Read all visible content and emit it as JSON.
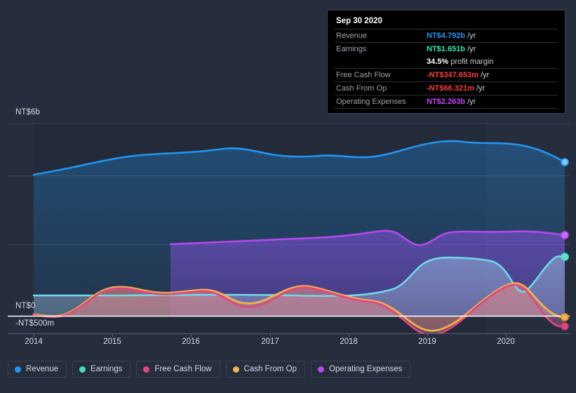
{
  "tooltip": {
    "title": "Sep 30 2020",
    "rows": [
      {
        "key": "Revenue",
        "amount": "NT$4.792b",
        "unit": "/yr",
        "color": "#2196f3"
      },
      {
        "key": "Earnings",
        "amount": "NT$1.651b",
        "unit": "/yr",
        "color": "#2ee6b8"
      },
      {
        "key": "",
        "amount": "34.5%",
        "unit": "profit margin",
        "color": "#ffffff"
      },
      {
        "key": "Free Cash Flow",
        "amount": "-NT$347.653m",
        "unit": "/yr",
        "color": "#ff3b3b"
      },
      {
        "key": "Cash From Op",
        "amount": "-NT$66.321m",
        "unit": "/yr",
        "color": "#ff3b3b"
      },
      {
        "key": "Operating Expenses",
        "amount": "NT$2.263b",
        "unit": "/yr",
        "color": "#c644fc"
      }
    ]
  },
  "axis": {
    "y_labels": [
      {
        "id": "y-top",
        "text": "NT$6b"
      },
      {
        "id": "y-zero",
        "text": "NT$0"
      },
      {
        "id": "y-neg",
        "text": "-NT$500m"
      }
    ],
    "x_labels": [
      "2014",
      "2015",
      "2016",
      "2017",
      "2018",
      "2019",
      "2020"
    ]
  },
  "legend": {
    "items": [
      {
        "label": "Revenue",
        "color": "#2196f3"
      },
      {
        "label": "Earnings",
        "color": "#3fe0c0"
      },
      {
        "label": "Free Cash Flow",
        "color": "#e0487f"
      },
      {
        "label": "Cash From Op",
        "color": "#f2b04e"
      },
      {
        "label": "Operating Expenses",
        "color": "#b847f0"
      }
    ]
  },
  "colors": {
    "background": "#262d3d",
    "plot_background": "#232a39",
    "gridline": "#4a5363",
    "zero_line": "#ffffff",
    "highlight_band": "#2c3444"
  },
  "chart_data": {
    "type": "area",
    "title": "",
    "xlabel": "",
    "ylabel": "NT$",
    "ylim": [
      -0.5,
      6.6
    ],
    "yticks": [
      6,
      0,
      -0.5
    ],
    "ytick_labels": [
      "NT$6b",
      "NT$0",
      "-NT$500m"
    ],
    "xlim": [
      "2013.8",
      "2020.85"
    ],
    "xticks": [
      "2014",
      "2015",
      "2016",
      "2017",
      "2018",
      "2019",
      "2020"
    ],
    "grid": true,
    "legend_position": "bottom",
    "units": "NT$ billions per year",
    "x": [
      2013.82,
      2014.0,
      2014.25,
      2014.5,
      2014.75,
      2015.0,
      2015.25,
      2015.5,
      2015.75,
      2016.0,
      2016.25,
      2016.5,
      2016.75,
      2017.0,
      2017.25,
      2017.5,
      2017.75,
      2018.0,
      2018.25,
      2018.5,
      2018.75,
      2019.0,
      2019.25,
      2019.5,
      2019.75,
      2020.0,
      2020.25,
      2020.5,
      2020.75
    ],
    "series": [
      {
        "name": "Revenue",
        "color": "#2196f3",
        "values": [
          4.4,
          4.47,
          4.55,
          4.62,
          4.72,
          4.84,
          4.97,
          5.03,
          5.04,
          5.06,
          5.07,
          5.1,
          5.14,
          5.2,
          5.13,
          5.05,
          5.05,
          5.09,
          5.02,
          5.04,
          5.18,
          5.3,
          5.38,
          5.32,
          5.3,
          5.37,
          5.28,
          5.22,
          4.79
        ],
        "end_value": 4.792,
        "end_label": "NT$4.792b"
      },
      {
        "name": "Earnings",
        "color": "#3fe0c0",
        "values": [
          0.62,
          0.62,
          0.62,
          0.62,
          0.62,
          0.62,
          0.62,
          0.62,
          0.62,
          0.63,
          0.63,
          0.64,
          0.64,
          0.64,
          0.64,
          0.63,
          0.62,
          0.62,
          0.63,
          0.64,
          0.7,
          1.25,
          1.7,
          1.72,
          1.66,
          1.4,
          0.95,
          1.35,
          1.651
        ],
        "end_value": 1.651,
        "end_label": "NT$1.651b"
      },
      {
        "name": "Free Cash Flow",
        "color": "#e0487f",
        "values": [
          0.03,
          0.01,
          -0.05,
          0.0,
          0.15,
          0.43,
          0.56,
          0.58,
          0.49,
          0.42,
          0.46,
          0.52,
          0.54,
          0.5,
          0.28,
          0.22,
          0.32,
          0.48,
          0.58,
          0.52,
          0.4,
          0.36,
          0.25,
          -0.18,
          -0.3,
          -0.05,
          0.45,
          0.9,
          -0.348
        ],
        "end_value": -0.347653,
        "end_label": "-NT$347.653m"
      },
      {
        "name": "Cash From Op",
        "color": "#f2b04e",
        "values": [
          0.05,
          0.02,
          -0.04,
          0.02,
          0.18,
          0.46,
          0.6,
          0.62,
          0.52,
          0.45,
          0.5,
          0.56,
          0.58,
          0.54,
          0.32,
          0.26,
          0.36,
          0.52,
          0.62,
          0.56,
          0.44,
          0.4,
          0.3,
          -0.14,
          -0.26,
          0.0,
          0.5,
          0.95,
          -0.066
        ],
        "end_value": -0.066321,
        "end_label": "-NT$66.321m"
      },
      {
        "name": "Operating Expenses",
        "color": "#b847f0",
        "values": [
          null,
          null,
          null,
          null,
          null,
          null,
          null,
          2.23,
          2.25,
          2.26,
          2.27,
          2.28,
          2.29,
          2.3,
          2.31,
          2.32,
          2.33,
          2.34,
          2.36,
          2.42,
          2.39,
          2.24,
          2.32,
          2.45,
          2.47,
          2.47,
          2.48,
          2.5,
          2.263
        ],
        "end_value": 2.263,
        "end_label": "NT$2.263b"
      }
    ]
  }
}
